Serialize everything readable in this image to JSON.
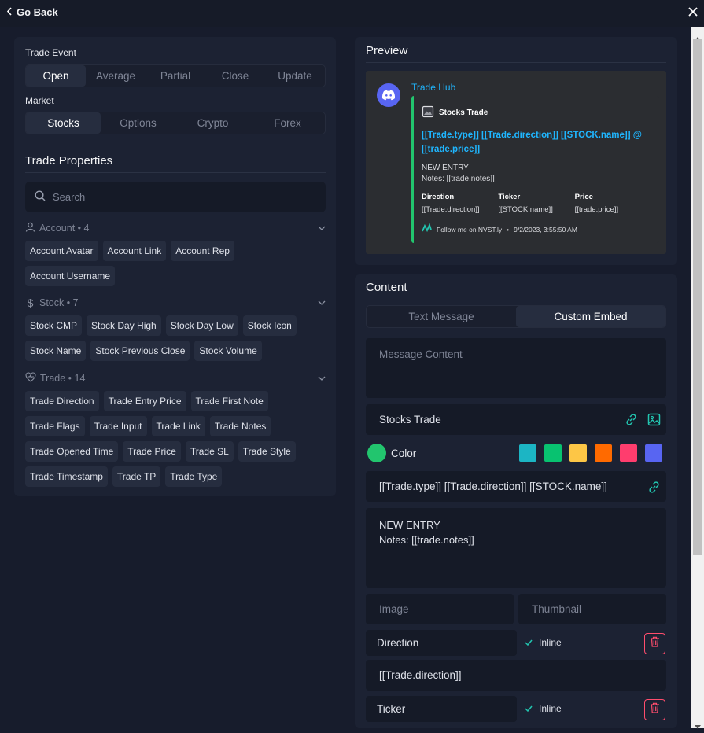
{
  "header": {
    "back_label": "Go Back"
  },
  "left": {
    "trade_event_label": "Trade Event",
    "trade_event_tabs": [
      "Open",
      "Average",
      "Partial",
      "Close",
      "Update"
    ],
    "market_label": "Market",
    "market_tabs": [
      "Stocks",
      "Options",
      "Crypto",
      "Forex"
    ],
    "properties_title": "Trade Properties",
    "search_placeholder": "Search",
    "groups": [
      {
        "name": "Account • 4",
        "chips": [
          "Account Avatar",
          "Account Link",
          "Account Rep",
          "Account Username"
        ]
      },
      {
        "name": "Stock • 7",
        "chips": [
          "Stock CMP",
          "Stock Day High",
          "Stock Day Low",
          "Stock Icon",
          "Stock Name",
          "Stock Previous Close",
          "Stock Volume"
        ]
      },
      {
        "name": "Trade • 14",
        "chips": [
          "Trade Direction",
          "Trade Entry Price",
          "Trade First Note",
          "Trade Flags",
          "Trade Input",
          "Trade Link",
          "Trade Notes",
          "Trade Opened Time",
          "Trade Price",
          "Trade SL",
          "Trade Style",
          "Trade Timestamp",
          "Trade TP",
          "Trade Type"
        ]
      }
    ]
  },
  "preview": {
    "title": "Preview",
    "bot_name": "Trade Hub",
    "author": "Stocks Trade",
    "embed_title": "[[Trade.type]] [[Trade.direction]] [[STOCK.name]] @ [[trade.price]]",
    "desc_line1": "NEW ENTRY",
    "desc_line2": "Notes: [[trade.notes]]",
    "fields": [
      {
        "name": "Direction",
        "value": "[[Trade.direction]]"
      },
      {
        "name": "Ticker",
        "value": "[[STOCK.name]]"
      },
      {
        "name": "Price",
        "value": "[[trade.price]]"
      }
    ],
    "footer": "Follow me on NVST.ly",
    "timestamp": "9/2/2023, 3:55:50 AM"
  },
  "content": {
    "title": "Content",
    "tabs": [
      "Text Message",
      "Custom Embed"
    ],
    "message_placeholder": "Message Content",
    "author_value": "Stocks Trade",
    "color_label": "Color",
    "color_selected": "#22c56e",
    "swatches": [
      "#1cb5c4",
      "#08c270",
      "#fdc646",
      "#ff6a00",
      "#ff3d6e",
      "#5865f2"
    ],
    "title_value": "[[Trade.type]] [[Trade.direction]] [[STOCK.name]]",
    "desc_line1": "NEW ENTRY",
    "desc_line2": "Notes: [[trade.notes]]",
    "image_placeholder": "Image",
    "thumbnail_placeholder": "Thumbnail",
    "field1_name": "Direction",
    "field1_inline": "Inline",
    "field1_value": "[[Trade.direction]]",
    "field2_name": "Ticker",
    "field2_inline": "Inline"
  }
}
